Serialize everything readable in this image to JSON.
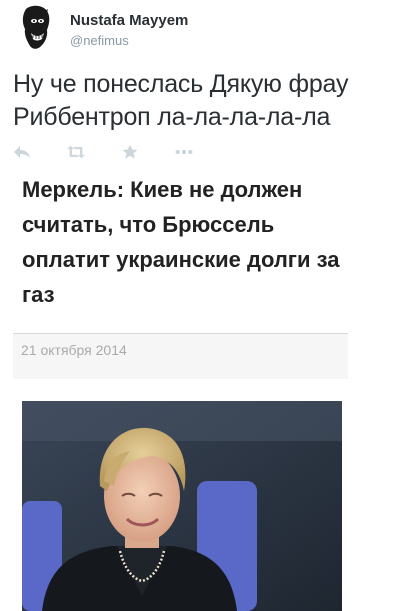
{
  "author": {
    "name": "Nustafa Mayyem",
    "handle": "@nefimus"
  },
  "tweet": {
    "text": "Ну че понеслась Дякую фрау Риббентроп ла-ла-ла-ла-ла"
  },
  "actions": {
    "icons": [
      "reply-icon",
      "retweet-icon",
      "favorite-icon",
      "more-icon"
    ]
  },
  "article": {
    "headline": "Меркель: Киев не должен считать, что Брюссель оплатит украинские долги за газ",
    "date": "21 октября  2014"
  },
  "colors": {
    "text": "#292f33",
    "handle": "#8899a6",
    "action_icon": "#ccd6dd",
    "date_bg": "#f6f6f6",
    "date_text": "#aaaaaa"
  }
}
